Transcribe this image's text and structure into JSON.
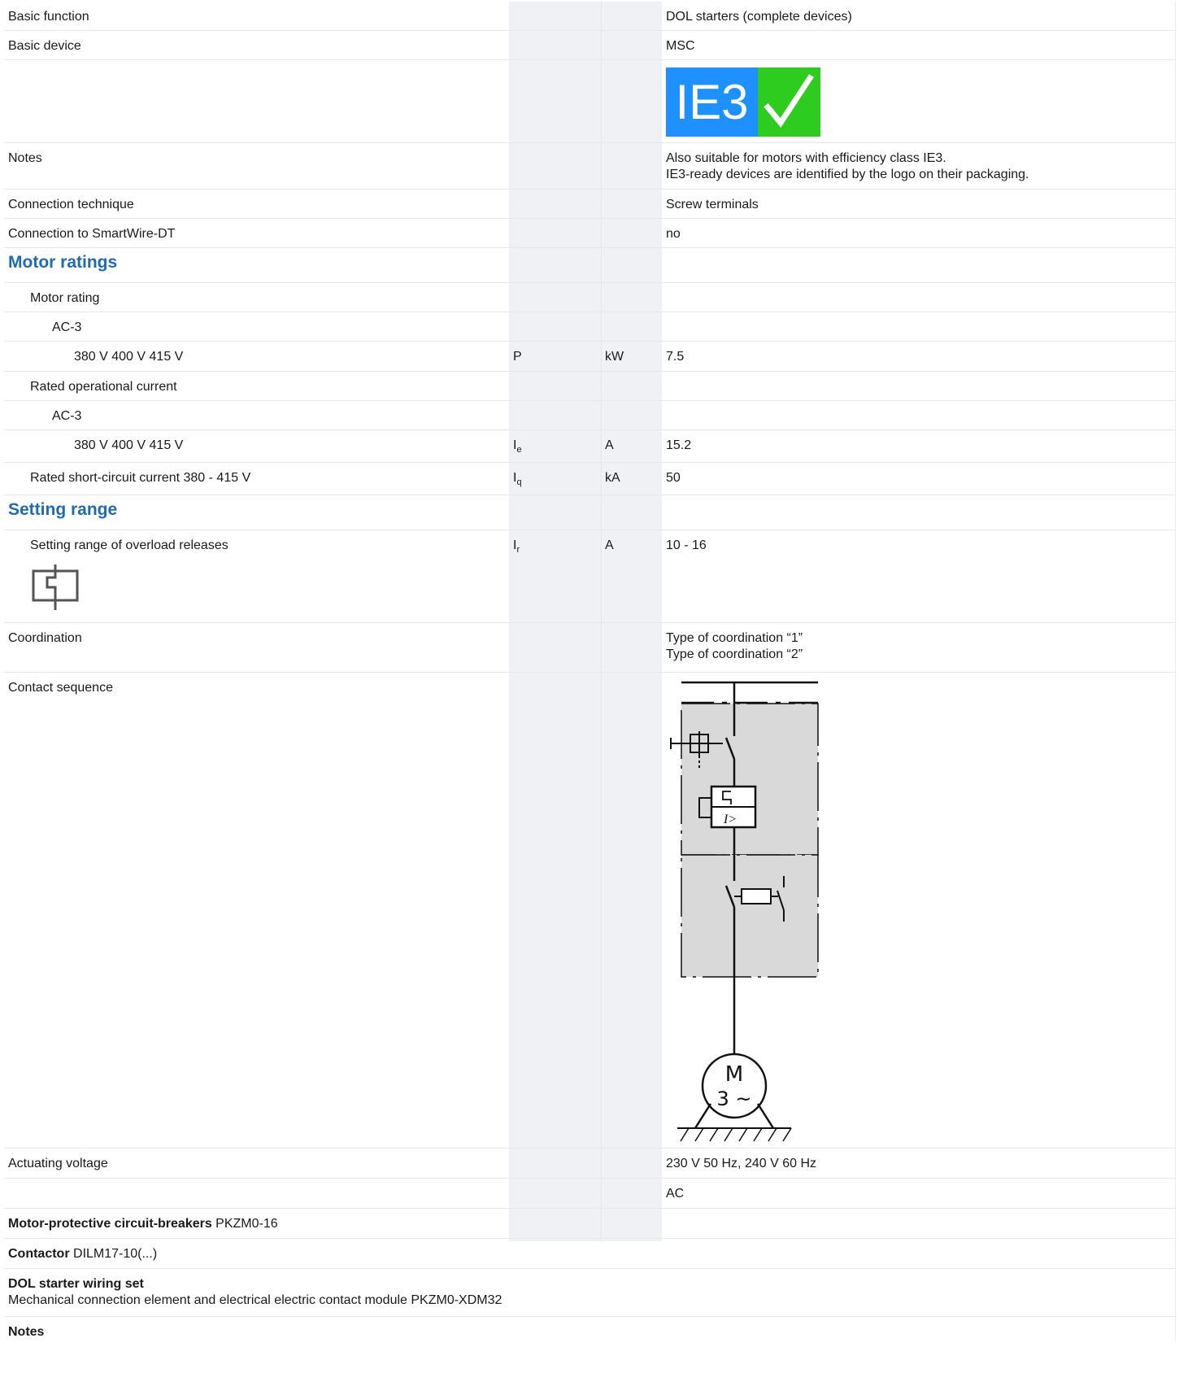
{
  "rows": {
    "basic_function": {
      "label": "Basic function",
      "value": "DOL starters (complete devices)"
    },
    "basic_device": {
      "label": "Basic device",
      "value": "MSC"
    },
    "ie3_logo": {
      "text": "IE3"
    },
    "notes": {
      "label": "Notes",
      "value_line1": "Also suitable for motors with efficiency class IE3.",
      "value_line2": "IE3-ready devices are identified by the logo on their packaging."
    },
    "connection_technique": {
      "label": "Connection technique",
      "value": "Screw terminals"
    },
    "smartwire": {
      "label": "Connection to SmartWire-DT",
      "value": "no"
    },
    "motor_ratings_heading": "Motor ratings",
    "motor_rating": {
      "label": "Motor rating"
    },
    "ac3_a": {
      "label": "AC-3"
    },
    "power_380": {
      "label": "380 V 400 V 415 V",
      "symbol": "P",
      "unit": "kW",
      "value": "7.5"
    },
    "rated_current": {
      "label": "Rated operational current"
    },
    "ac3_b": {
      "label": "AC-3"
    },
    "current_380": {
      "label": "380 V 400 V 415 V",
      "symbol": "I",
      "symbol_sub": "e",
      "unit": "A",
      "value": "15.2"
    },
    "short_circuit": {
      "label": "Rated short-circuit current 380 - 415 V",
      "symbol": "I",
      "symbol_sub": "q",
      "unit": "kA",
      "value": "50"
    },
    "setting_range_heading": "Setting range",
    "overload": {
      "label": "Setting range of overload releases",
      "symbol": "I",
      "symbol_sub": "r",
      "unit": "A",
      "value": "10 - 16"
    },
    "coordination": {
      "label": "Coordination",
      "value_line1": "Type of coordination “1”",
      "value_line2": "Type of coordination “2”"
    },
    "contact_sequence": {
      "label": "Contact sequence",
      "diagram": {
        "motor_line1": "M",
        "motor_line2": "3 ~",
        "trip_label": "I>"
      }
    },
    "actuating_voltage": {
      "label": "Actuating voltage",
      "value": "230 V 50 Hz, 240 V 60 Hz"
    },
    "actuating_type": {
      "value": "AC"
    },
    "mpcb": {
      "bold": "Motor-protective circuit-breakers",
      "text": " PKZM0-16"
    },
    "contactor": {
      "bold": "Contactor",
      "text": " DILM17-10(...)"
    },
    "wiring_set": {
      "bold": "DOL starter wiring set",
      "text": "Mechanical connection element and electrical electric contact module PKZM0-XDM32"
    },
    "notes_footer": {
      "bold": "Notes"
    }
  },
  "colors": {
    "heading": "#1f6ab5",
    "logo_blue": "#1e90ff",
    "logo_green": "#2ecc1f",
    "band": "#eff1f4"
  }
}
